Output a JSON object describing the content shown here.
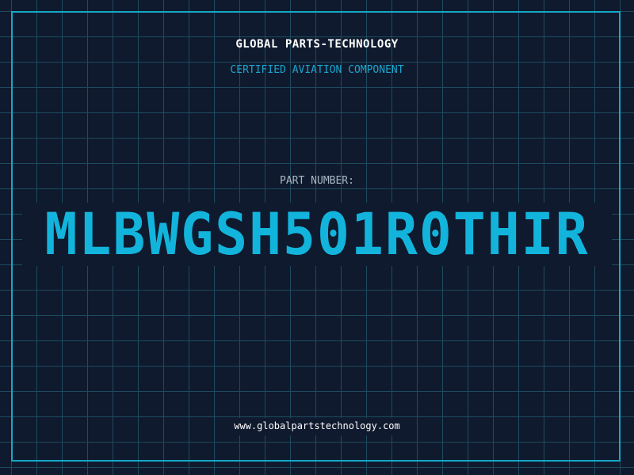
{
  "header": {
    "company": "GLOBAL PARTS-TECHNOLOGY",
    "subtitle": "CERTIFIED AVIATION COMPONENT"
  },
  "part": {
    "label": "PART NUMBER:",
    "number": "MLBWGSH501R0THIR"
  },
  "footer": {
    "url": "www.globalpartstechnology.com"
  },
  "colors": {
    "background": "#0f1a2e",
    "grid": "#1f4a5e",
    "accent": "#14a8c8",
    "title": "#ffffff",
    "label": "#a9b7c6"
  }
}
